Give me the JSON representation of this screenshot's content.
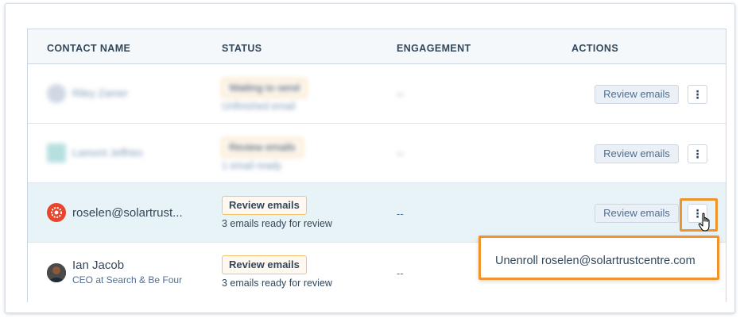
{
  "table": {
    "headers": {
      "contact_name": "CONTACT NAME",
      "status": "STATUS",
      "engagement": "ENGAGEMENT",
      "actions": "ACTIONS"
    },
    "rows": [
      {
        "name": "Riley Zamer",
        "status_label": "Waiting to send",
        "status_sub": "Unfinished email",
        "engagement": "--",
        "action_label": "Review emails"
      },
      {
        "name": "Lamont Jeffries",
        "status_label": "Review emails",
        "status_sub": "1 email ready",
        "engagement": "--",
        "action_label": "Review emails"
      },
      {
        "name": "roselen@solartrust...",
        "status_label": "Review emails",
        "status_sub": "3 emails ready for review",
        "engagement": "--",
        "action_label": "Review emails"
      },
      {
        "name": "Ian Jacob",
        "subtitle": "CEO at Search & Be Four",
        "status_label": "Review emails",
        "status_sub": "3 emails ready for review",
        "engagement": "--"
      }
    ]
  },
  "more_icon": "⋮",
  "dropdown": {
    "item": "Unenroll roselen@solartrustcentre.com"
  },
  "colors": {
    "highlight_row": "#e8f3f7",
    "orange_annotation": "#f0932b",
    "badge_border": "#f5c26b"
  }
}
